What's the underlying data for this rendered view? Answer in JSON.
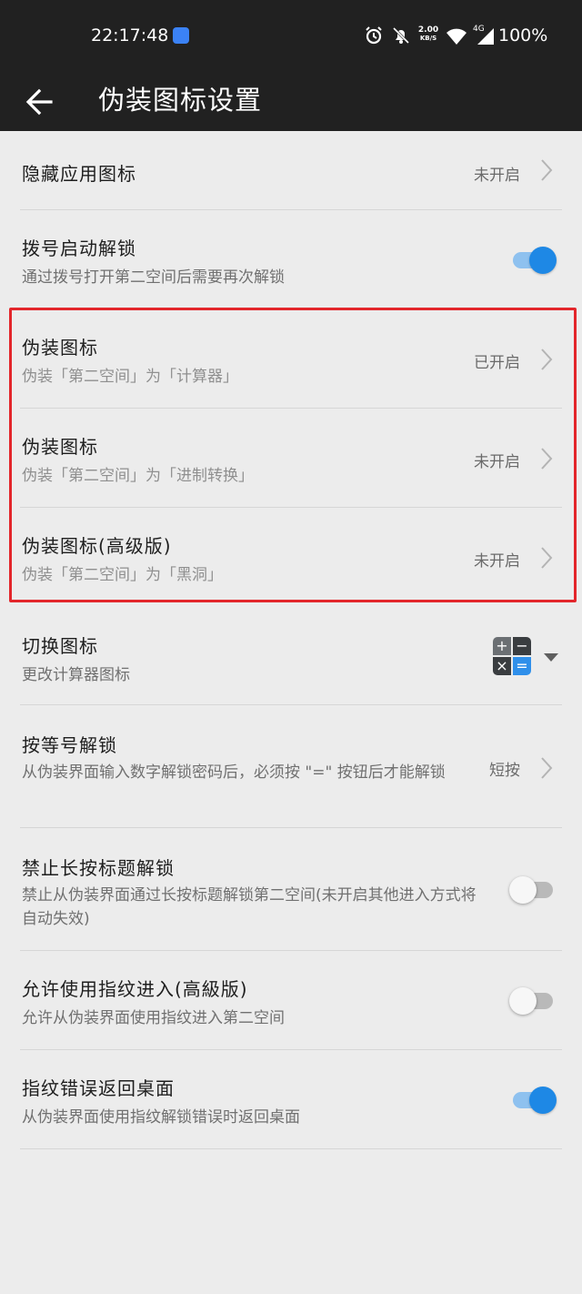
{
  "status_bar": {
    "time": "22:17:48",
    "net_speed_value": "2.00",
    "net_speed_unit": "KB/S",
    "net_type": "4G",
    "battery": "100%"
  },
  "header": {
    "title": "伪装图标设置"
  },
  "settings": [
    {
      "title": "隐藏应用图标",
      "value": "未开启"
    },
    {
      "title": "拨号启动解锁",
      "subtitle": "通过拨号打开第二空间后需要再次解锁",
      "toggle": "on"
    },
    {
      "title": "伪装图标",
      "subtitle": "伪装「第二空间」为「计算器」",
      "value": "已开启"
    },
    {
      "title": "伪装图标",
      "subtitle": "伪装「第二空间」为「进制转换」",
      "value": "未开启"
    },
    {
      "title": "伪装图标(高级版)",
      "subtitle": "伪装「第二空间」为「黑洞」",
      "value": "未开启"
    },
    {
      "title": "切换图标",
      "subtitle": "更改计算器图标"
    },
    {
      "title": "按等号解锁",
      "subtitle": "从伪装界面输入数字解锁密码后，必须按 \"=\" 按钮后才能解锁",
      "value": "短按"
    },
    {
      "title": "禁止长按标题解锁",
      "subtitle": "禁止从伪装界面通过长按标题解锁第二空间(未开启其他进入方式将自动失效)",
      "toggle": "off"
    },
    {
      "title": "允许使用指纹进入(高級版)",
      "subtitle": "允许从伪装界面使用指纹进入第二空间",
      "toggle": "off"
    },
    {
      "title": "指纹错误返回桌面",
      "subtitle": "从伪装界面使用指纹解锁错误时返回桌面",
      "toggle": "on"
    }
  ],
  "calc_icon_glyphs": {
    "plus": "+",
    "minus": "−",
    "times": "×",
    "equals": "="
  },
  "colors": {
    "accent": "#1e88e5",
    "highlight_border": "#e3262b",
    "bar_background": "#212121",
    "page_background": "#ececec"
  }
}
